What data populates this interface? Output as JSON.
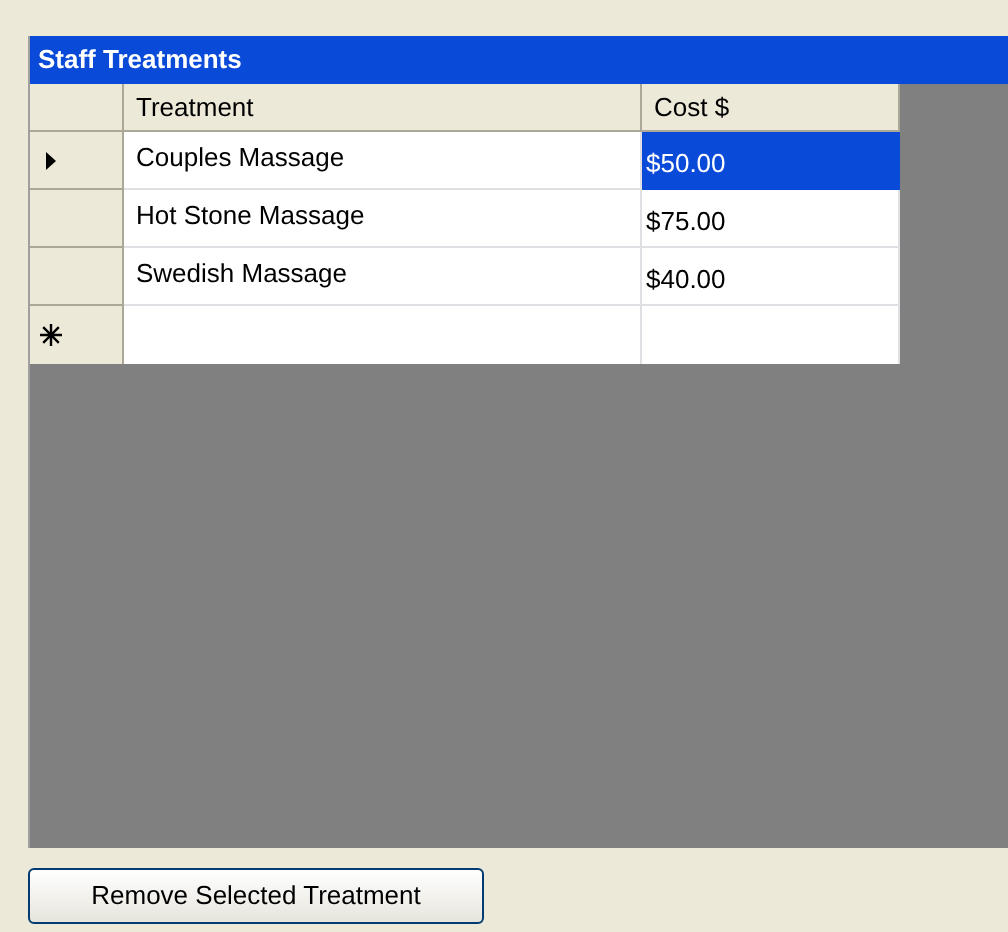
{
  "grid": {
    "caption": "Staff Treatments",
    "columns": [
      "Treatment",
      "Cost $"
    ],
    "rows": [
      {
        "treatment": "Couples Massage",
        "cost": "$50.00",
        "current": true,
        "selected": true
      },
      {
        "treatment": "Hot Stone Massage",
        "cost": "$75.00",
        "current": false,
        "selected": false
      },
      {
        "treatment": "Swedish Massage",
        "cost": "$40.00",
        "current": false,
        "selected": false
      }
    ]
  },
  "buttons": [
    "Remove Selected Treatment"
  ]
}
